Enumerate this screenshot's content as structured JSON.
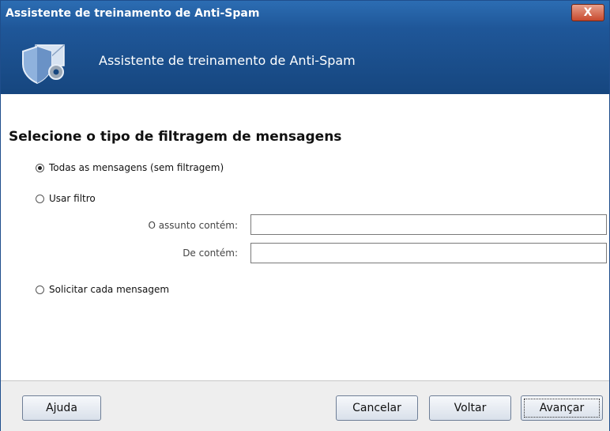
{
  "window": {
    "title": "Assistente de treinamento de Anti-Spam",
    "close_label": "X"
  },
  "header": {
    "title": "Assistente de treinamento de Anti-Spam",
    "icon": "shield-envelope-gear-icon"
  },
  "main": {
    "section_title": "Selecione o tipo de filtragem de mensagens",
    "options": [
      {
        "label": "Todas as mensagens (sem filtragem)",
        "selected": true
      },
      {
        "label": "Usar filtro",
        "selected": false
      },
      {
        "label": "Solicitar cada mensagem",
        "selected": false
      }
    ],
    "filter": {
      "subject_label": "O assunto contém:",
      "subject_value": "",
      "from_label": "De contém:",
      "from_value": ""
    }
  },
  "footer": {
    "help_label": "Ajuda",
    "cancel_label": "Cancelar",
    "back_label": "Voltar",
    "next_label": "Avançar"
  },
  "colors": {
    "title_bar": "#1f5799",
    "accent": "#2c6db3"
  }
}
